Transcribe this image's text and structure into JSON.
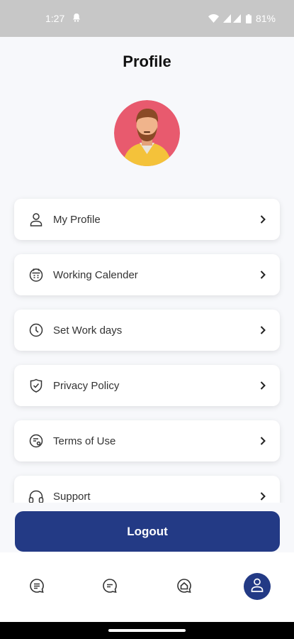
{
  "status_bar": {
    "time": "1:27",
    "battery": "81%"
  },
  "header": {
    "title": "Profile"
  },
  "menu": {
    "items": [
      {
        "label": "My Profile",
        "icon": "person-icon"
      },
      {
        "label": "Working Calender",
        "icon": "calendar-icon"
      },
      {
        "label": "Set Work days",
        "icon": "clock-icon"
      },
      {
        "label": "Privacy Policy",
        "icon": "shield-check-icon"
      },
      {
        "label": "Terms of Use",
        "icon": "document-badge-icon"
      },
      {
        "label": "Support",
        "icon": "headphones-icon"
      }
    ]
  },
  "logout": {
    "label": "Logout"
  },
  "bottom_nav": {
    "items": [
      {
        "icon": "list-icon",
        "active": false
      },
      {
        "icon": "chat-icon",
        "active": false
      },
      {
        "icon": "home-icon",
        "active": false
      },
      {
        "icon": "person-icon",
        "active": true
      }
    ]
  },
  "colors": {
    "primary": "#233a85",
    "background": "#f7f8fb",
    "status_bar": "#c7c7c7"
  }
}
